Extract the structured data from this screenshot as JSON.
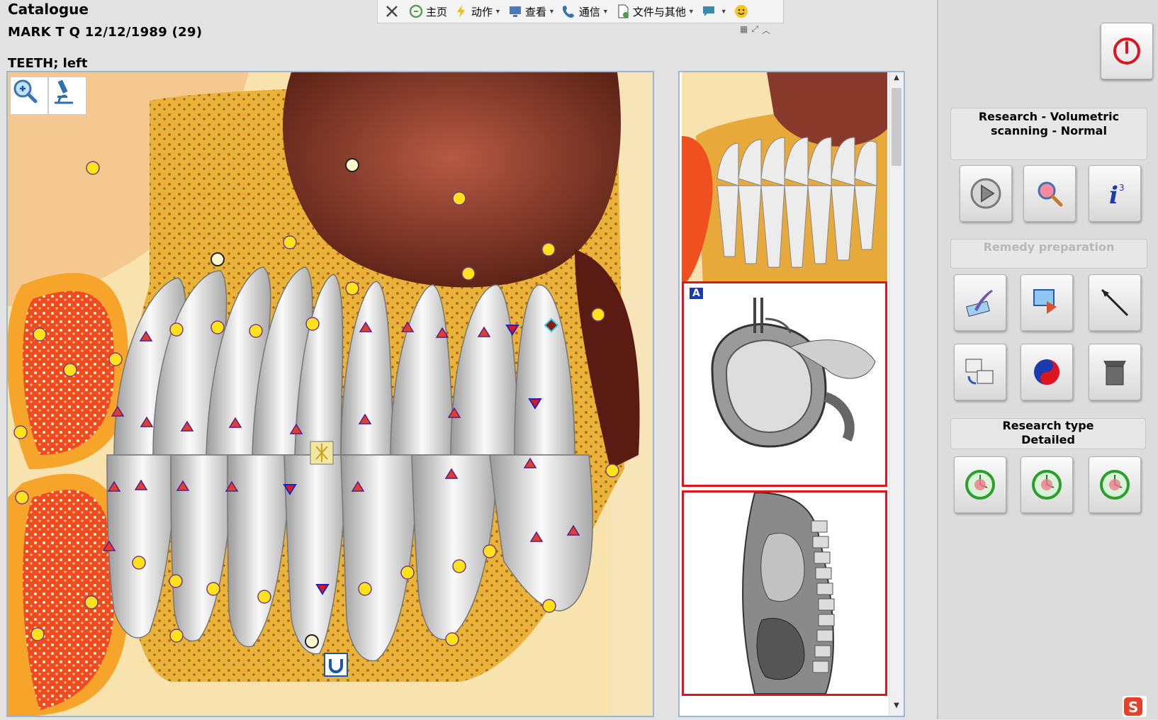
{
  "header": {
    "title": "Catalogue",
    "patient": "MARK T Q  12/12/1989 (29)",
    "organ": "TEETH; left"
  },
  "toolbar": {
    "items": [
      {
        "label": "主页",
        "icon": "home-icon"
      },
      {
        "label": "动作",
        "icon": "lightning-icon"
      },
      {
        "label": "查看",
        "icon": "monitor-icon"
      },
      {
        "label": "通信",
        "icon": "phone-icon"
      },
      {
        "label": "文件与其他",
        "icon": "document-icon"
      }
    ]
  },
  "main_view": {
    "tools": [
      "zoom-icon",
      "microscope-icon"
    ],
    "center_button_icon": "magnet-icon"
  },
  "thumbnails": {
    "items": [
      {
        "name": "teeth-thumbnail",
        "badge": ""
      },
      {
        "name": "intestine-thumbnail",
        "badge": "A"
      },
      {
        "name": "spine-section-thumbnail",
        "badge": ""
      }
    ]
  },
  "right_panel": {
    "research_mode_label": "Research - Volumetric scanning - Normal",
    "remedy_label": "Remedy preparation",
    "research_type_label": "Research type Detailed"
  },
  "colors": {
    "marker_yellow": "#ffe21a",
    "marker_red": "#e0402a",
    "marker_blue": "#1a22c8",
    "selection_red": "#e0141c",
    "frame_blue": "#9ab8d6"
  }
}
